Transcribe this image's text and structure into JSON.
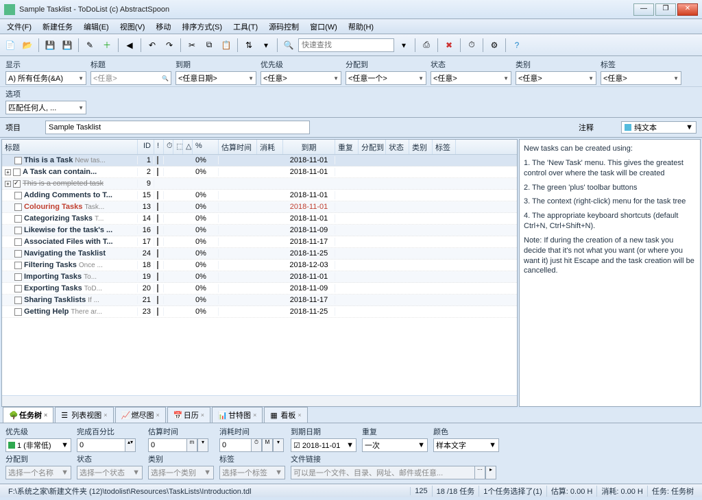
{
  "window": {
    "title": "Sample Tasklist - ToDoList (c) AbstractSpoon"
  },
  "menu": [
    "文件(F)",
    "新建任务",
    "编辑(E)",
    "视图(V)",
    "移动",
    "排序方式(S)",
    "工具(T)",
    "源码控制",
    "窗口(W)",
    "帮助(H)"
  ],
  "toolbar_search_placeholder": "快速查找",
  "filters": {
    "labels": {
      "show": "显示",
      "title": "标题",
      "due": "到期",
      "priority": "优先级",
      "alloc": "分配到",
      "status": "状态",
      "category": "类别",
      "tag": "标签",
      "option": "选项"
    },
    "show_value": "A) 所有任务(&A)",
    "title_value": "<任意>",
    "due_value": "<任意日期>",
    "priority_value": "<任意>",
    "alloc_value": "<任意一个>",
    "status_value": "<任意>",
    "category_value": "<任意>",
    "tag_value": "<任意>",
    "option_value": "匹配任何人, ..."
  },
  "project": {
    "label": "项目",
    "value": "Sample Tasklist"
  },
  "grid": {
    "headers": {
      "title": "标题",
      "id": "ID",
      "pct": "%",
      "est": "估算时间",
      "spent": "消耗",
      "due": "到期",
      "recur": "重复",
      "alloc": "分配到",
      "status": "状态",
      "cat": "类别",
      "tag": "标签"
    },
    "rows": [
      {
        "exp": "",
        "chk": false,
        "title": "This is a Task",
        "note": "New tas...",
        "id": 1,
        "color": "#2fa84f",
        "pct": "0%",
        "due": "2018-11-01",
        "sel": true
      },
      {
        "exp": "+",
        "chk": false,
        "title": "A Task can contain...",
        "note": "",
        "id": 2,
        "color": "#2fa84f",
        "pct": "0%",
        "due": "2018-11-01"
      },
      {
        "exp": "+",
        "chk": true,
        "title": "This is a completed task",
        "note": "",
        "id": 9,
        "color": "",
        "pct": "",
        "due": "",
        "completed": true
      },
      {
        "exp": "",
        "chk": false,
        "title": "Adding Comments to T...",
        "note": "",
        "id": 15,
        "color": "#3a7fc4",
        "pct": "0%",
        "due": "2018-11-01"
      },
      {
        "exp": "",
        "chk": false,
        "title": "Colouring Tasks",
        "note": "Task...",
        "id": 13,
        "color": "#3a7fc4",
        "pct": "0%",
        "due": "2018-11-01",
        "red": true,
        "sel": false
      },
      {
        "exp": "",
        "chk": false,
        "title": "Categorizing Tasks",
        "note": "T...",
        "id": 14,
        "color": "#3a5fc4",
        "pct": "0%",
        "due": "2018-11-01"
      },
      {
        "exp": "",
        "chk": false,
        "title": "Likewise for the task's ...",
        "note": "",
        "id": 16,
        "color": "#4a4fc4",
        "pct": "0%",
        "due": "2018-11-09"
      },
      {
        "exp": "",
        "chk": false,
        "title": "Associated Files with T...",
        "note": "",
        "id": 17,
        "color": "#5a3fc4",
        "pct": "0%",
        "due": "2018-11-17"
      },
      {
        "exp": "",
        "chk": false,
        "title": "Navigating the Tasklist",
        "note": "",
        "id": 24,
        "color": "#6a3fc4",
        "pct": "0%",
        "due": "2018-11-25"
      },
      {
        "exp": "",
        "chk": false,
        "title": "Filtering Tasks",
        "note": "Once ...",
        "id": 18,
        "color": "#8a3fb4",
        "pct": "0%",
        "due": "2018-12-03"
      },
      {
        "exp": "",
        "chk": false,
        "title": "Importing Tasks",
        "note": "To...",
        "id": 19,
        "color": "#b03f94",
        "pct": "0%",
        "due": "2018-11-01"
      },
      {
        "exp": "",
        "chk": false,
        "title": "Exporting Tasks",
        "note": "ToD...",
        "id": 20,
        "color": "#c43f84",
        "pct": "0%",
        "due": "2018-11-09"
      },
      {
        "exp": "",
        "chk": false,
        "title": "Sharing Tasklists",
        "note": "If ...",
        "id": 21,
        "color": "#d43f74",
        "pct": "0%",
        "due": "2018-11-17"
      },
      {
        "exp": "",
        "chk": false,
        "title": "Getting Help",
        "note": "There ar...",
        "id": 23,
        "color": "#e43f64",
        "pct": "0%",
        "due": "2018-11-25"
      }
    ]
  },
  "comments": {
    "label": "注释",
    "type": "纯文本",
    "body": [
      "New tasks can be created using:",
      "1. The 'New Task' menu. This gives the greatest control over where the task will be created",
      "2. The green 'plus' toolbar buttons",
      "3. The context (right-click) menu for the task tree",
      "4. The appropriate keyboard shortcuts (default Ctrl+N, Ctrl+Shift+N).",
      "Note: If during the creation of a new task you decide that it's not what you want (or where you want it) just hit Escape and the task creation will be cancelled."
    ]
  },
  "viewtabs": [
    {
      "label": "任务树",
      "active": true
    },
    {
      "label": "列表视图"
    },
    {
      "label": "燃尽图"
    },
    {
      "label": "日历"
    },
    {
      "label": "甘特图"
    },
    {
      "label": "看板"
    }
  ],
  "edit": {
    "labels": {
      "priority": "优先级",
      "pct": "完成百分比",
      "est": "估算时间",
      "spent": "消耗时间",
      "duedate": "到期日期",
      "recur": "重复",
      "color": "颜色",
      "alloc": "分配到",
      "status": "状态",
      "category": "类别",
      "tag": "标签",
      "filelink": "文件链接"
    },
    "priority_value": "1 (非常低)",
    "pct_value": "0",
    "est_value": "0",
    "est_unit": "m",
    "spent_value": "0",
    "spent_unit": "M",
    "duedate_value": "2018-11-01",
    "recur_value": "一次",
    "color_value": "样本文字",
    "alloc_value": "选择一个名称",
    "status_value": "选择一个状态",
    "category_value": "选择一个类别",
    "tag_value": "选择一个标签",
    "filelink_value": "可以是一个文件、目录、网址、邮件或任意..."
  },
  "status": {
    "path": "F:\\系统之家\\新建文件夹 (12)\\todolist\\Resources\\TaskLists\\Introduction.tdl",
    "pos": "125",
    "tasks": "18 /18 任务",
    "sel": "1个任务选择了(1)",
    "est": "估算: 0.00 H",
    "spent": "消耗: 0.00 H",
    "view": "任务: 任务树"
  }
}
